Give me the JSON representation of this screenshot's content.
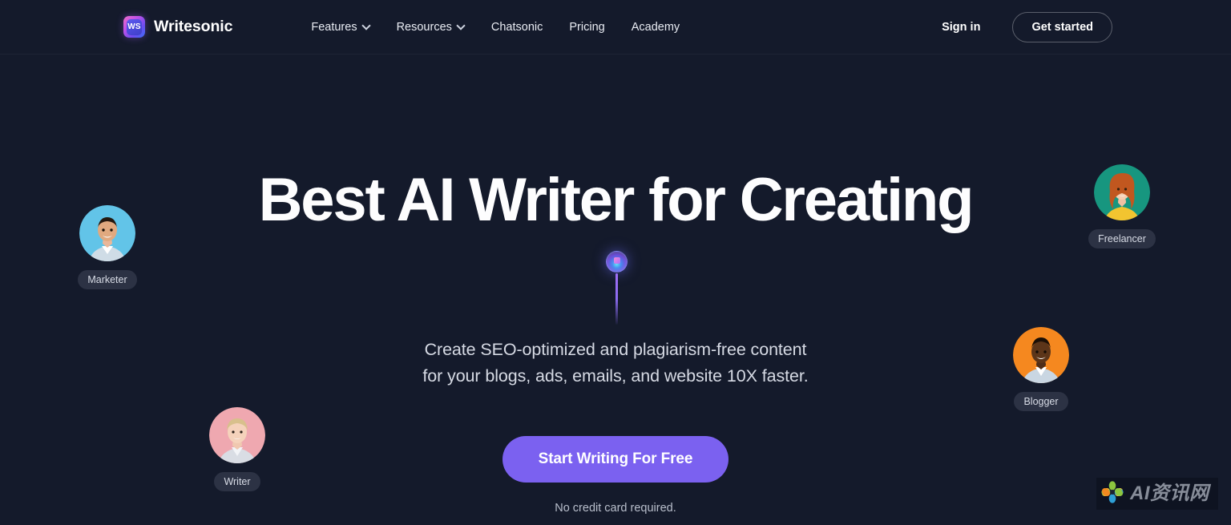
{
  "brand": {
    "logo_icon": "writesonic-logo-icon",
    "logo_initials": "WS",
    "name": "Writesonic"
  },
  "header": {
    "nav_items": [
      {
        "label": "Features",
        "has_dropdown": true
      },
      {
        "label": "Resources",
        "has_dropdown": true
      },
      {
        "label": "Chatsonic",
        "has_dropdown": false
      },
      {
        "label": "Pricing",
        "has_dropdown": false
      },
      {
        "label": "Academy",
        "has_dropdown": false
      }
    ],
    "sign_in_label": "Sign in",
    "get_started_label": "Get started"
  },
  "hero": {
    "headline": "Best AI Writer for Creating",
    "subtitle_line_1": "Create SEO-optimized and plagiarism-free content",
    "subtitle_line_2": "for your blogs, ads, emails, and website 10X faster.",
    "cta_label": "Start Writing For Free",
    "cta_note": "No credit card required.",
    "wand_icon": "ai-wand-orb-icon"
  },
  "personas": [
    {
      "tag": "Marketer",
      "avatar_icon": "avatar-marketer-icon",
      "bg": "#62c4e8"
    },
    {
      "tag": "Writer",
      "avatar_icon": "avatar-writer-icon",
      "bg": "#efa8b0"
    },
    {
      "tag": "Freelancer",
      "avatar_icon": "avatar-freelancer-icon",
      "bg": "#17967f"
    },
    {
      "tag": "Blogger",
      "avatar_icon": "avatar-blogger-icon",
      "bg": "#f5881f"
    }
  ],
  "watermark": {
    "logo_icon": "flower-pinwheel-icon",
    "text": "AI资讯网"
  },
  "colors": {
    "background": "#141a2b",
    "accent_purple": "#7b61f0",
    "tag_background": "#2c3244",
    "text_primary": "#ffffff",
    "text_secondary": "#d6dae4"
  }
}
